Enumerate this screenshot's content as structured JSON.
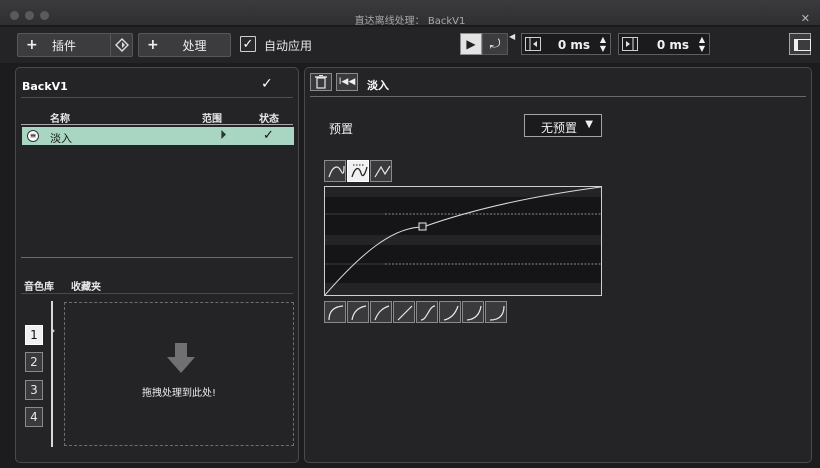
{
  "window": {
    "title": "直达离线处理： BackV1"
  },
  "toolbar": {
    "plugin_label": "插件",
    "process_label": "处理",
    "auto_apply_label": "自动应用",
    "auto_apply_checked": true,
    "pre_ms": "0 ms",
    "post_ms": "0 ms"
  },
  "left": {
    "title": "BackV1",
    "columns": {
      "name": "名称",
      "range": "范围",
      "status": "状态"
    },
    "rows": [
      {
        "name": "淡入"
      }
    ],
    "library_tabs": [
      "音色库",
      "收藏夹"
    ],
    "slots": [
      "1",
      "2",
      "3",
      "4"
    ],
    "drop_text": "拖拽处理到此处!"
  },
  "right": {
    "title": "淡入",
    "preset_label": "预置",
    "preset_value": "无预置",
    "curve_modes": [
      "spline-icon",
      "damped-spline-icon",
      "linear-icon"
    ],
    "shape_presets": [
      "curve-1-icon",
      "curve-2-icon",
      "curve-3-icon",
      "curve-4-icon",
      "curve-5-icon",
      "curve-6-icon",
      "curve-7-icon",
      "curve-8-icon"
    ]
  },
  "colors": {
    "selection": "#a8d6c2",
    "background": "#242426"
  }
}
